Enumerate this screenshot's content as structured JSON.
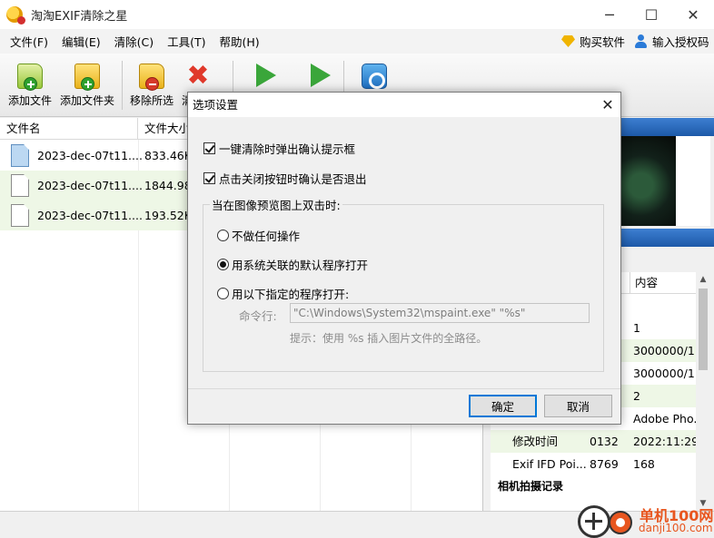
{
  "window": {
    "title": "淘淘EXIF清除之星",
    "controls": {
      "minimize": "─",
      "maximize": "☐",
      "close": "✕"
    }
  },
  "menubar": {
    "items": [
      "文件(F)",
      "编辑(E)",
      "清除(C)",
      "工具(T)",
      "帮助(H)"
    ],
    "buy_label": "购买软件",
    "license_label": "输入授权码"
  },
  "toolbar": {
    "add_file": "添加文件",
    "add_folder": "添加文件夹",
    "remove_selected": "移除所选",
    "clear_partial": "清"
  },
  "file_list": {
    "columns": [
      "文件名",
      "文件大小"
    ],
    "rows": [
      {
        "name": "2023-dec-07t11....",
        "size": "833.46K"
      },
      {
        "name": "2023-dec-07t11....",
        "size": "1844.98"
      },
      {
        "name": "2023-dec-07t11....",
        "size": "193.52K"
      }
    ]
  },
  "properties": {
    "columns": [
      "",
      "内容"
    ],
    "rows": [
      {
        "tag": "",
        "value": "1"
      },
      {
        "tag": "",
        "value": "3000000/1."
      },
      {
        "tag": "",
        "value": "3000000/1."
      },
      {
        "tag": "",
        "value": "2"
      },
      {
        "tag": "",
        "value": "Adobe Pho."
      },
      {
        "name": "修改时间",
        "tag": "0132",
        "value": "2022:11:29"
      },
      {
        "name": "Exif IFD Poi...",
        "tag": "8769",
        "value": "168"
      }
    ],
    "group_label": "相机拍摄记录"
  },
  "watermark": {
    "text": "单机100网",
    "sub": "danji100.com"
  },
  "dialog": {
    "title": "选项设置",
    "close": "✕",
    "check_confirm_clear": "一键清除时弹出确认提示框",
    "check_confirm_exit": "点击关闭按钮时确认是否退出",
    "group_label": "当在图像预览图上双击时:",
    "radio_none": "不做任何操作",
    "radio_default": "用系统关联的默认程序打开",
    "radio_custom": "用以下指定的程序打开:",
    "cmd_label": "命令行:",
    "cmd_value": "\"C:\\Windows\\System32\\mspaint.exe\" \"%s\"",
    "hint": "提示：使用 %s 插入图片文件的全路径。",
    "ok": "确定",
    "cancel": "取消"
  }
}
